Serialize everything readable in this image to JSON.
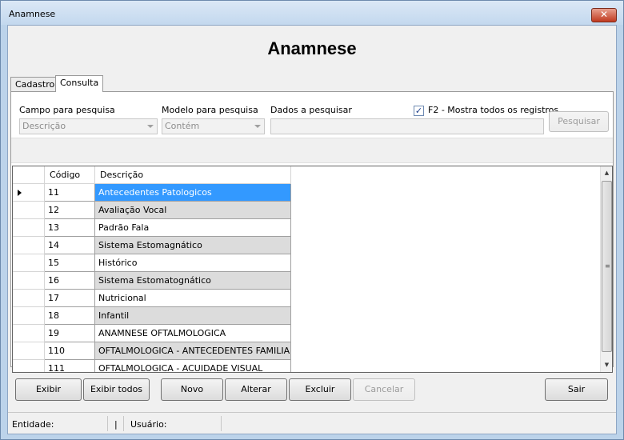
{
  "window": {
    "title": "Anamnese",
    "close_glyph": "✕"
  },
  "heading": "Anamnese",
  "tabs": [
    {
      "label": "Cadastro",
      "active": false
    },
    {
      "label": "Consulta",
      "active": true
    }
  ],
  "search": {
    "campo_label": "Campo para pesquisa",
    "campo_value": "Descrição",
    "modelo_label": "Modelo para pesquisa",
    "modelo_value": "Contém",
    "dados_label": "Dados a pesquisar",
    "dados_value": "",
    "f2_checked": true,
    "f2_check_glyph": "✓",
    "f2_label": "F2 - Mostra todos os registros",
    "pesquisar_label": "Pesquisar"
  },
  "grid": {
    "columns": [
      "Código",
      "Descrição"
    ],
    "rows": [
      {
        "codigo": "11",
        "descricao": "Antecedentes Patologicos",
        "selected": true
      },
      {
        "codigo": "12",
        "descricao": "Avaliação Vocal"
      },
      {
        "codigo": "13",
        "descricao": "Padrão Fala"
      },
      {
        "codigo": "14",
        "descricao": "Sistema Estomagnático"
      },
      {
        "codigo": "15",
        "descricao": "Histórico"
      },
      {
        "codigo": "16",
        "descricao": "Sistema Estomatognático"
      },
      {
        "codigo": "17",
        "descricao": "Nutricional"
      },
      {
        "codigo": "18",
        "descricao": "Infantil"
      },
      {
        "codigo": "19",
        "descricao": "ANAMNESE OFTALMOLOGICA"
      },
      {
        "codigo": "110",
        "descricao": "OFTALMOLOGICA - ANTECEDENTES FAMILIARES"
      },
      {
        "codigo": "111",
        "descricao": "OFTALMOLOGICA - ACUIDADE VISUAL"
      }
    ],
    "colors": {
      "selected_bg": "#3399ff",
      "selected_fg": "#ffffff",
      "alt_bg": "#dcdcdc",
      "row_bg": "#ffffff"
    }
  },
  "scrollbar": {
    "up_glyph": "▲",
    "down_glyph": "▼",
    "grip_glyph": "≡"
  },
  "buttons": {
    "exibir": "Exibir",
    "exibir_todos": "Exibir todos",
    "novo": "Novo",
    "alterar": "Alterar",
    "excluir": "Excluir",
    "cancelar": "Cancelar",
    "sair": "Sair"
  },
  "status": {
    "entidade_label": "Entidade:",
    "separator": "|",
    "usuario_label": "Usuário:"
  }
}
